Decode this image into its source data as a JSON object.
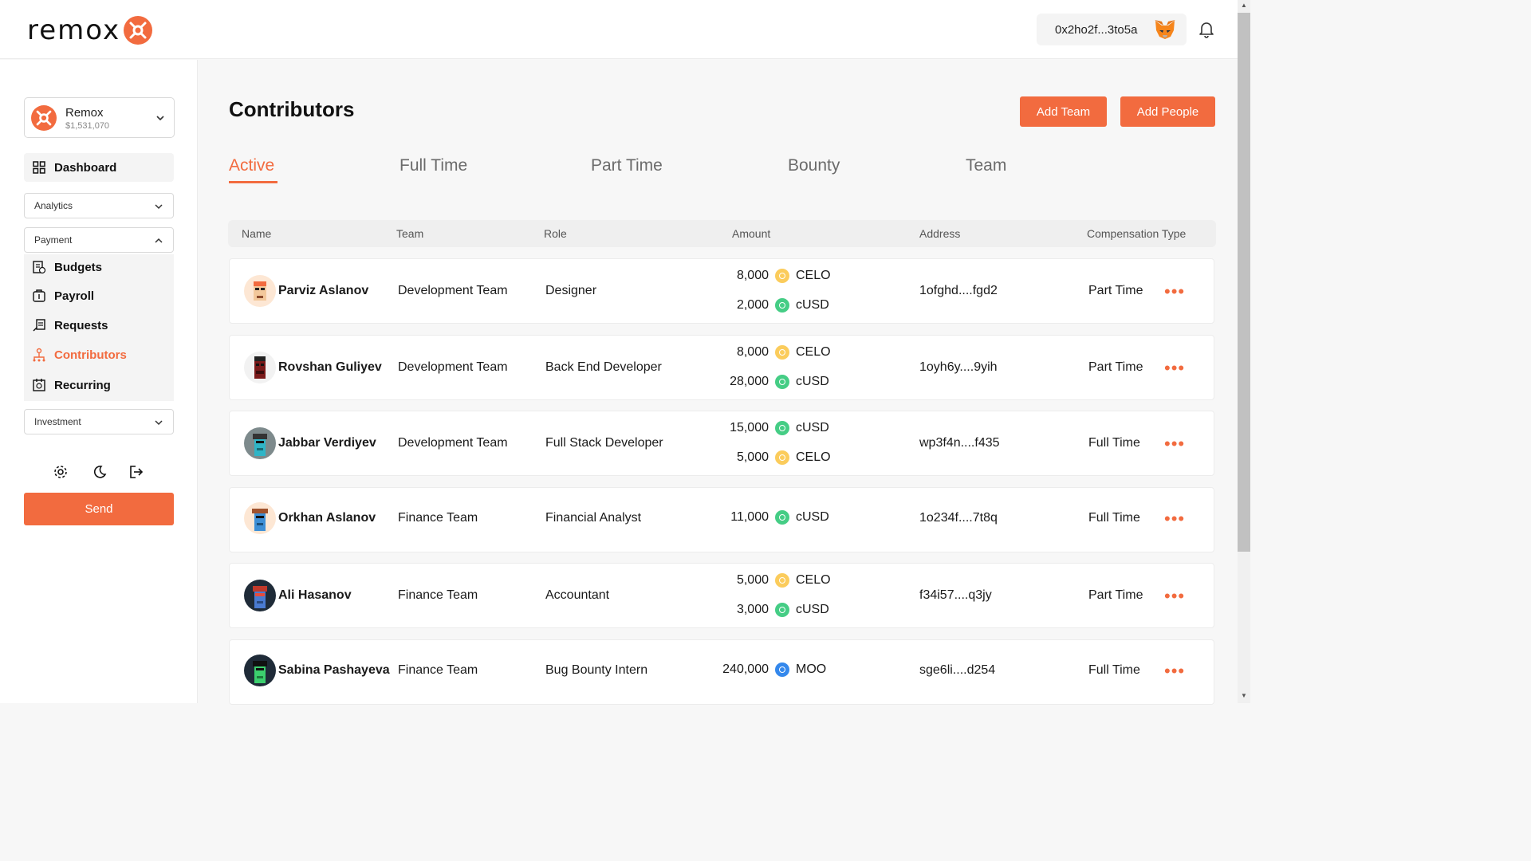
{
  "header": {
    "logo_text": "remox",
    "wallet_address": "0x2ho2f...3to5a"
  },
  "sidebar": {
    "account": {
      "name": "Remox",
      "balance": "$1,531,070"
    },
    "dashboard_label": "Dashboard",
    "analytics_label": "Analytics",
    "payment_label": "Payment",
    "payment_items": [
      {
        "label": "Budgets",
        "icon": "budget-icon"
      },
      {
        "label": "Payroll",
        "icon": "payroll-icon"
      },
      {
        "label": "Requests",
        "icon": "requests-icon"
      },
      {
        "label": "Contributors",
        "icon": "contributors-icon",
        "active": true
      },
      {
        "label": "Recurring",
        "icon": "recurring-icon"
      }
    ],
    "investment_label": "Investment",
    "send_label": "Send"
  },
  "main": {
    "title": "Contributors",
    "add_team_label": "Add Team",
    "add_people_label": "Add People",
    "tabs": [
      {
        "label": "Active",
        "active": true
      },
      {
        "label": "Full Time"
      },
      {
        "label": "Part Time"
      },
      {
        "label": "Bounty"
      },
      {
        "label": "Team"
      }
    ],
    "columns": [
      "Name",
      "Team",
      "Role",
      "Amount",
      "Address",
      "Compensation Type"
    ],
    "rows": [
      {
        "name": "Parviz Aslanov",
        "team": "Development Team",
        "role": "Designer",
        "amounts": [
          {
            "value": "8,000",
            "coin": "CELO"
          },
          {
            "value": "2,000",
            "coin": "cUSD"
          }
        ],
        "address": "1ofghd....fgd2",
        "compensation": "Part Time"
      },
      {
        "name": "Rovshan Guliyev",
        "team": "Development Team",
        "role": "Back End Developer",
        "amounts": [
          {
            "value": "8,000",
            "coin": "CELO"
          },
          {
            "value": "28,000",
            "coin": "cUSD"
          }
        ],
        "address": "1oyh6y....9yih",
        "compensation": "Part Time"
      },
      {
        "name": "Jabbar Verdiyev",
        "team": "Development Team",
        "role": "Full Stack Developer",
        "amounts": [
          {
            "value": "15,000",
            "coin": "cUSD"
          },
          {
            "value": "5,000",
            "coin": "CELO"
          }
        ],
        "address": "wp3f4n....f435",
        "compensation": "Full Time"
      },
      {
        "name": "Orkhan Aslanov",
        "team": "Finance Team",
        "role": "Financial Analyst",
        "amounts": [
          {
            "value": "11,000",
            "coin": "cUSD"
          }
        ],
        "address": "1o234f....7t8q",
        "compensation": "Full Time"
      },
      {
        "name": "Ali Hasanov",
        "team": "Finance Team",
        "role": "Accountant",
        "amounts": [
          {
            "value": "5,000",
            "coin": "CELO"
          },
          {
            "value": "3,000",
            "coin": "cUSD"
          }
        ],
        "address": "f34i57....q3jy",
        "compensation": "Part Time"
      },
      {
        "name": "Sabina Pashayeva",
        "team": "Finance Team",
        "role": "Bug Bounty Intern",
        "amounts": [
          {
            "value": "240,000",
            "coin": "MOO"
          }
        ],
        "address": "sge6li....d254",
        "compensation": "Full Time"
      }
    ]
  },
  "colors": {
    "accent": "#f26b3f",
    "celo": "#fbcc5c",
    "cusd": "#45cd85",
    "moo": "#3488ec"
  }
}
